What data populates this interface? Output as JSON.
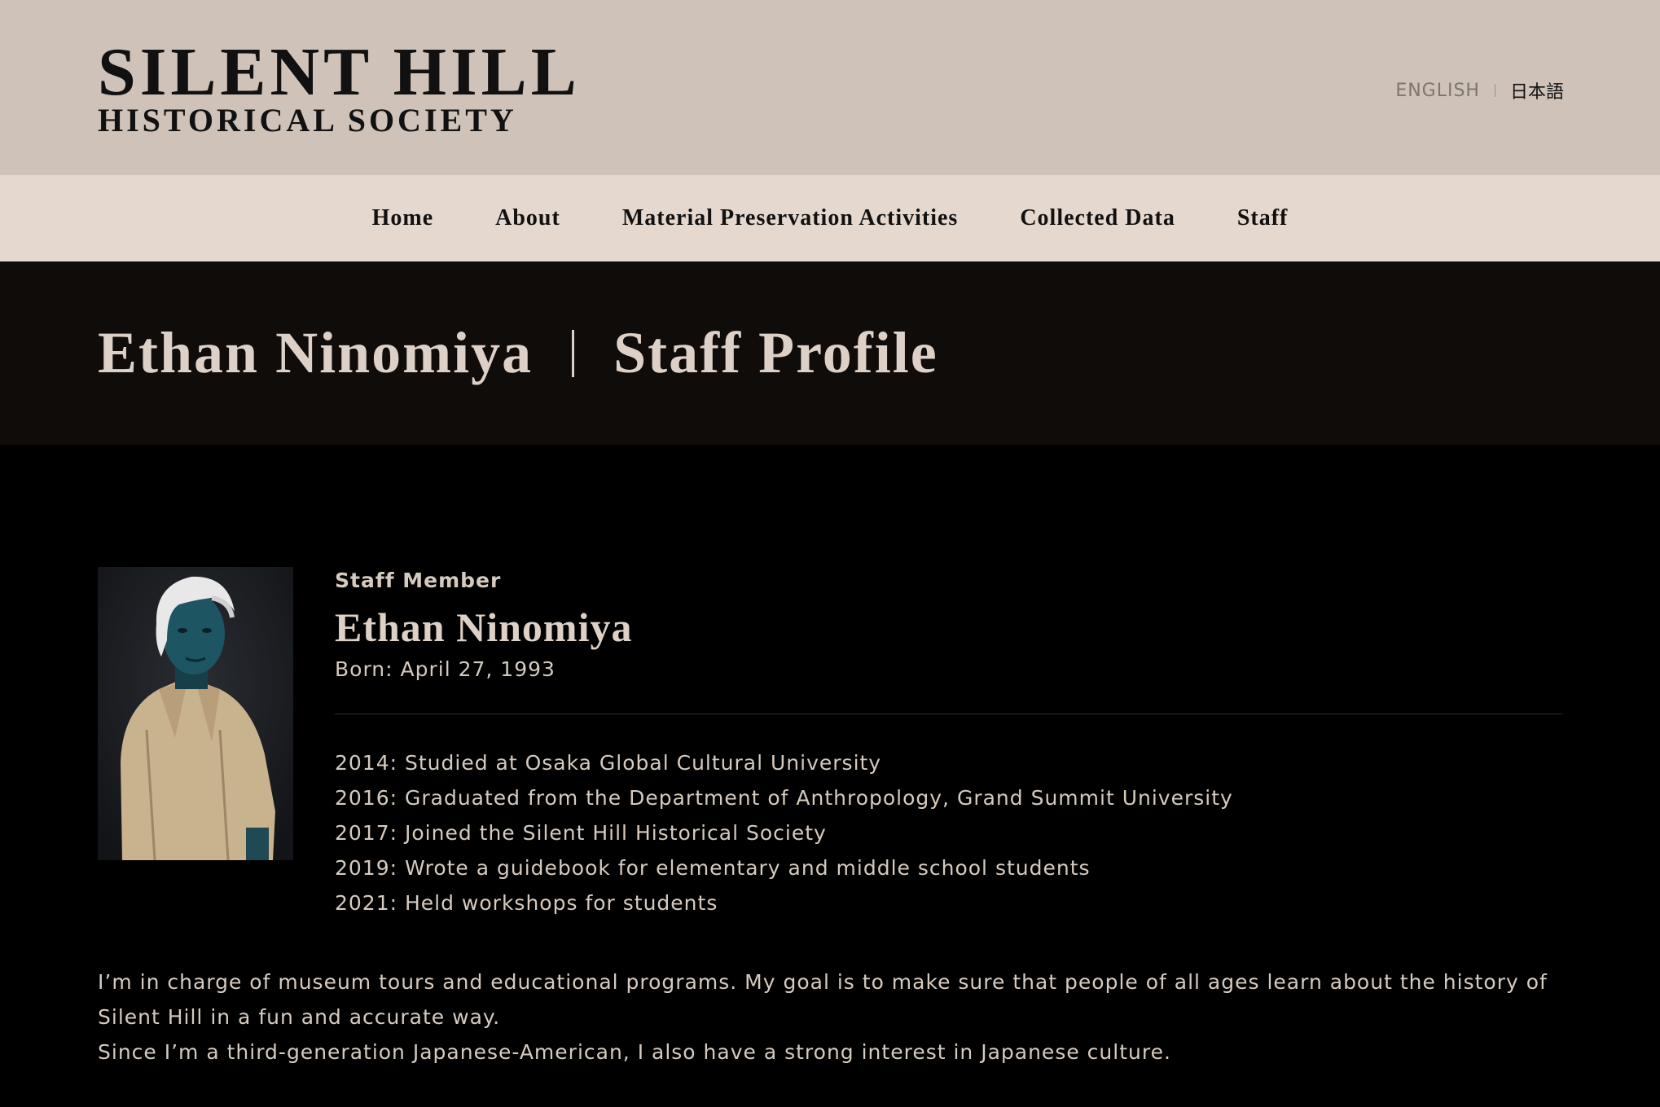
{
  "header": {
    "logo_line1": "SILENT HILL",
    "logo_line2": "HISTORICAL SOCIETY",
    "lang_english": "ENGLISH",
    "lang_japanese": "日本語"
  },
  "nav": {
    "items": [
      {
        "label": "Home"
      },
      {
        "label": "About"
      },
      {
        "label": "Material Preservation Activities"
      },
      {
        "label": "Collected Data"
      },
      {
        "label": "Staff"
      }
    ]
  },
  "banner": {
    "name": "Ethan Ninomiya",
    "section": "Staff Profile"
  },
  "profile": {
    "role": "Staff Member",
    "name": "Ethan Ninomiya",
    "born": "Born: April 27, 1993",
    "timeline": [
      "2014: Studied at Osaka Global Cultural University",
      "2016: Graduated from the Department of Anthropology, Grand Summit University",
      "2017: Joined the Silent Hill Historical Society",
      "2019: Wrote a guidebook for elementary and middle school students",
      "2021: Held workshops for students"
    ],
    "bio": [
      "I’m in charge of museum tours and educational programs. My goal is to make sure that people of all ages learn about the history of Silent Hill in a fun and accurate way.",
      "Since I’m a third-generation Japanese-American, I also have a strong interest in Japanese culture."
    ]
  },
  "colors": {
    "header_bg": "#cec2b9",
    "nav_bg": "#e5d9cf",
    "banner_bg": "#100c0a",
    "content_bg": "#000000",
    "text_light": "#d6cabf"
  }
}
